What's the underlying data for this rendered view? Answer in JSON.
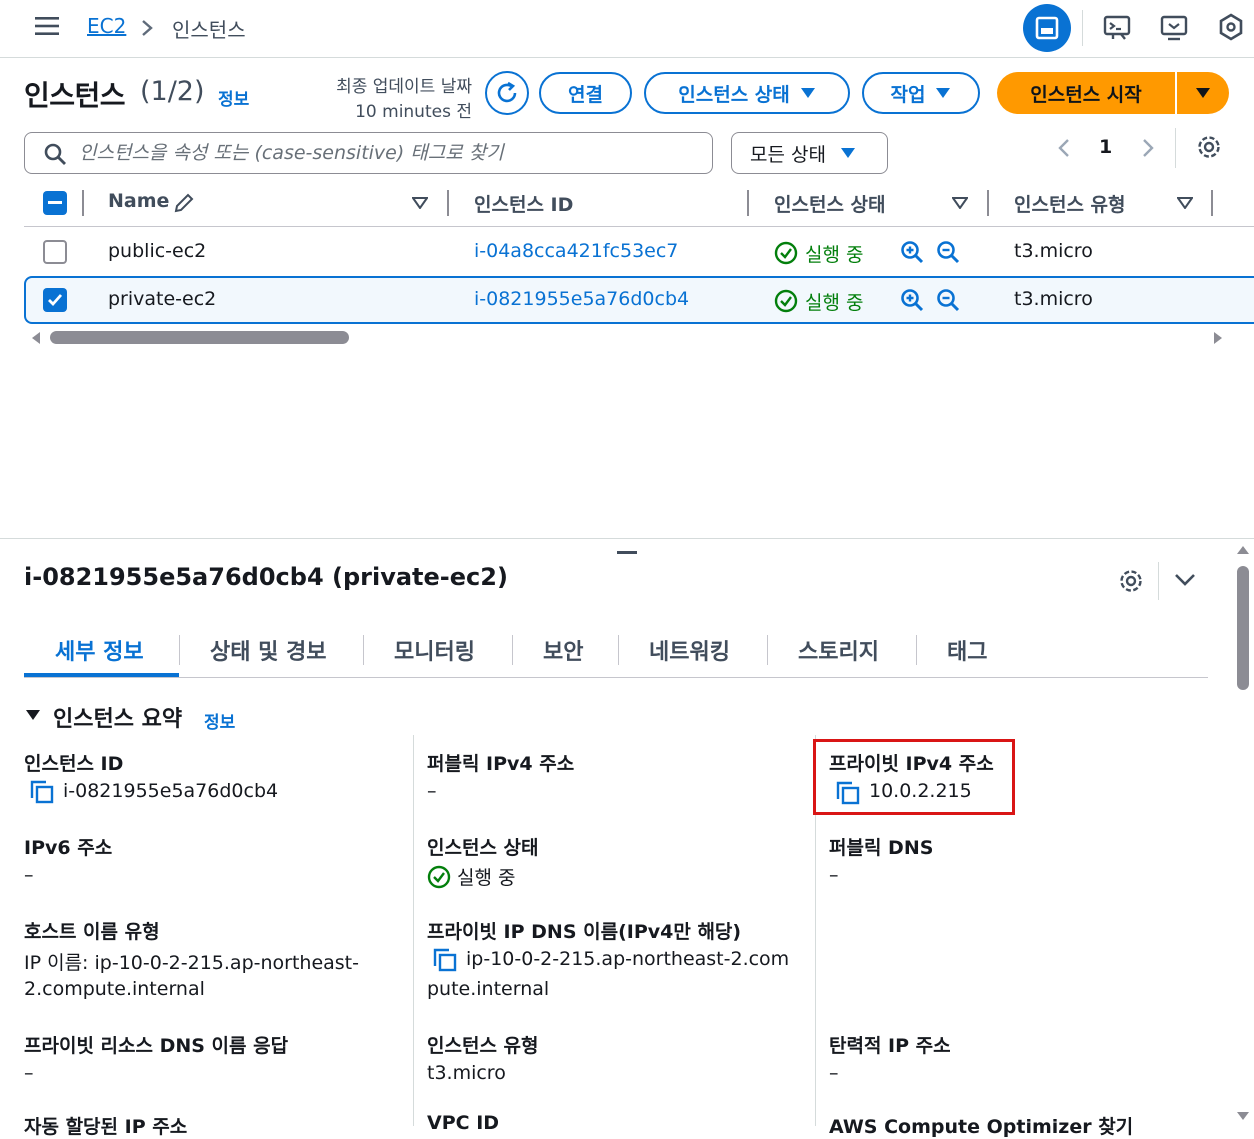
{
  "breadcrumb": {
    "root": "EC2",
    "current": "인스턴스"
  },
  "header": {
    "title": "인스턴스",
    "count": "(1/2)",
    "info": "정보",
    "updated_label": "최종 업데이트 날짜",
    "updated_value": "10 minutes 전",
    "connect": "연결",
    "instance_state": "인스턴스 상태",
    "actions": "작업",
    "launch": "인스턴스 시작"
  },
  "search": {
    "placeholder": "인스턴스을 속성 또는 (case-sensitive) 태그로 찾기"
  },
  "filter": {
    "selected": "모든 상태"
  },
  "pagination": {
    "page": "1"
  },
  "table": {
    "columns": [
      "Name",
      "인스턴스 ID",
      "인스턴스 상태",
      "인스턴스 유형"
    ],
    "rows": [
      {
        "name": "public-ec2",
        "id": "i-04a8cca421fc53ec7",
        "state": "실행 중",
        "type": "t3.micro",
        "selected": false
      },
      {
        "name": "private-ec2",
        "id": "i-0821955e5a76d0cb4",
        "state": "실행 중",
        "type": "t3.micro",
        "selected": true
      }
    ]
  },
  "detail": {
    "title": "i-0821955e5a76d0cb4 (private-ec2)",
    "tabs": [
      "세부 정보",
      "상태 및 경보",
      "모니터링",
      "보안",
      "네트워킹",
      "스토리지",
      "태그"
    ],
    "section_title": "인스턴스 요약",
    "section_info": "정보",
    "fields": {
      "instance_id_label": "인스턴스 ID",
      "instance_id_value": "i-0821955e5a76d0cb4",
      "public_ipv4_label": "퍼블릭 IPv4 주소",
      "public_ipv4_value": "–",
      "private_ipv4_label": "프라이빗 IPv4 주소",
      "private_ipv4_value": "10.0.2.215",
      "ipv6_label": "IPv6 주소",
      "ipv6_value": "–",
      "state_label": "인스턴스 상태",
      "state_value": "실행 중",
      "public_dns_label": "퍼블릭 DNS",
      "public_dns_value": "–",
      "hostname_type_label": "호스트 이름 유형",
      "hostname_type_line1": "IP 이름: ip-10-0-2-215.ap-northeast-",
      "hostname_type_line2": "2.compute.internal",
      "private_dns_label": "프라이빗 IP DNS 이름(IPv4만 해당)",
      "private_dns_line1": "ip-10-0-2-215.ap-northeast-2.com",
      "private_dns_line2": "pute.internal",
      "resource_dns_label": "프라이빗 리소스 DNS 이름 응답",
      "resource_dns_value": "–",
      "instance_type_label": "인스턴스 유형",
      "instance_type_value": "t3.micro",
      "elastic_ip_label": "탄력적 IP 주소",
      "elastic_ip_value": "–",
      "auto_ip_label": "자동 할당된 IP 주소",
      "vpc_id_label": "VPC ID",
      "optimizer_label": "AWS Compute Optimizer 찾기"
    }
  },
  "colors": {
    "accent": "#0972d3",
    "launch": "#ff9900",
    "running": "#037f0c",
    "highlight": "#d91515"
  }
}
